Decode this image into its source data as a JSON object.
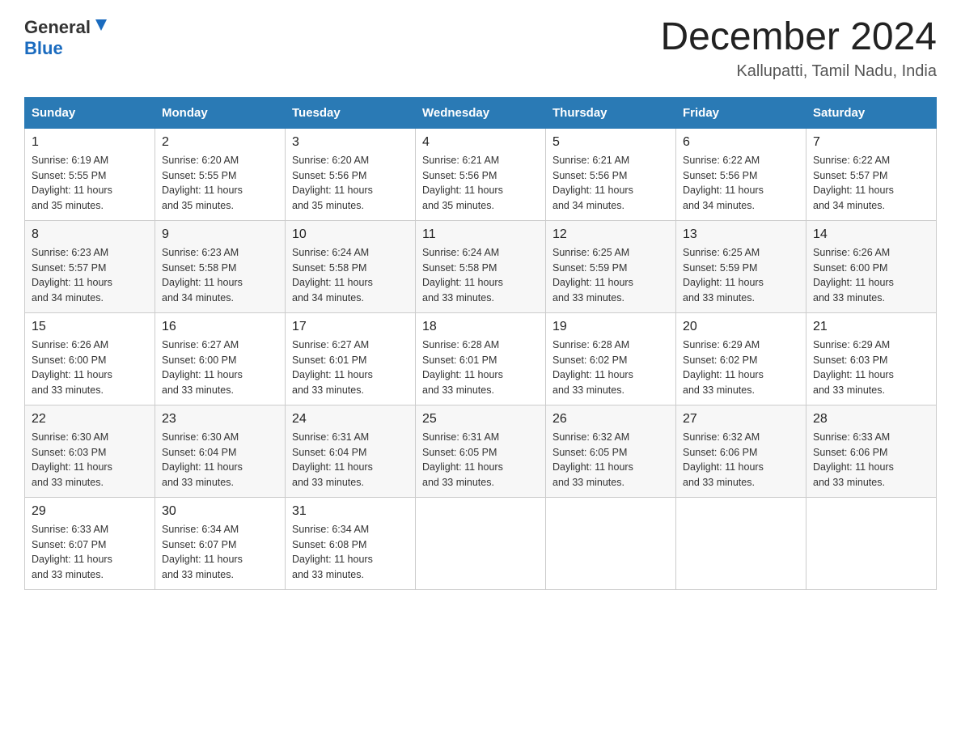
{
  "header": {
    "logo_general": "General",
    "logo_blue": "Blue",
    "title": "December 2024",
    "subtitle": "Kallupatti, Tamil Nadu, India"
  },
  "days_of_week": [
    "Sunday",
    "Monday",
    "Tuesday",
    "Wednesday",
    "Thursday",
    "Friday",
    "Saturday"
  ],
  "weeks": [
    [
      {
        "num": "1",
        "sunrise": "6:19 AM",
        "sunset": "5:55 PM",
        "daylight": "11 hours and 35 minutes."
      },
      {
        "num": "2",
        "sunrise": "6:20 AM",
        "sunset": "5:55 PM",
        "daylight": "11 hours and 35 minutes."
      },
      {
        "num": "3",
        "sunrise": "6:20 AM",
        "sunset": "5:56 PM",
        "daylight": "11 hours and 35 minutes."
      },
      {
        "num": "4",
        "sunrise": "6:21 AM",
        "sunset": "5:56 PM",
        "daylight": "11 hours and 35 minutes."
      },
      {
        "num": "5",
        "sunrise": "6:21 AM",
        "sunset": "5:56 PM",
        "daylight": "11 hours and 34 minutes."
      },
      {
        "num": "6",
        "sunrise": "6:22 AM",
        "sunset": "5:56 PM",
        "daylight": "11 hours and 34 minutes."
      },
      {
        "num": "7",
        "sunrise": "6:22 AM",
        "sunset": "5:57 PM",
        "daylight": "11 hours and 34 minutes."
      }
    ],
    [
      {
        "num": "8",
        "sunrise": "6:23 AM",
        "sunset": "5:57 PM",
        "daylight": "11 hours and 34 minutes."
      },
      {
        "num": "9",
        "sunrise": "6:23 AM",
        "sunset": "5:58 PM",
        "daylight": "11 hours and 34 minutes."
      },
      {
        "num": "10",
        "sunrise": "6:24 AM",
        "sunset": "5:58 PM",
        "daylight": "11 hours and 34 minutes."
      },
      {
        "num": "11",
        "sunrise": "6:24 AM",
        "sunset": "5:58 PM",
        "daylight": "11 hours and 33 minutes."
      },
      {
        "num": "12",
        "sunrise": "6:25 AM",
        "sunset": "5:59 PM",
        "daylight": "11 hours and 33 minutes."
      },
      {
        "num": "13",
        "sunrise": "6:25 AM",
        "sunset": "5:59 PM",
        "daylight": "11 hours and 33 minutes."
      },
      {
        "num": "14",
        "sunrise": "6:26 AM",
        "sunset": "6:00 PM",
        "daylight": "11 hours and 33 minutes."
      }
    ],
    [
      {
        "num": "15",
        "sunrise": "6:26 AM",
        "sunset": "6:00 PM",
        "daylight": "11 hours and 33 minutes."
      },
      {
        "num": "16",
        "sunrise": "6:27 AM",
        "sunset": "6:00 PM",
        "daylight": "11 hours and 33 minutes."
      },
      {
        "num": "17",
        "sunrise": "6:27 AM",
        "sunset": "6:01 PM",
        "daylight": "11 hours and 33 minutes."
      },
      {
        "num": "18",
        "sunrise": "6:28 AM",
        "sunset": "6:01 PM",
        "daylight": "11 hours and 33 minutes."
      },
      {
        "num": "19",
        "sunrise": "6:28 AM",
        "sunset": "6:02 PM",
        "daylight": "11 hours and 33 minutes."
      },
      {
        "num": "20",
        "sunrise": "6:29 AM",
        "sunset": "6:02 PM",
        "daylight": "11 hours and 33 minutes."
      },
      {
        "num": "21",
        "sunrise": "6:29 AM",
        "sunset": "6:03 PM",
        "daylight": "11 hours and 33 minutes."
      }
    ],
    [
      {
        "num": "22",
        "sunrise": "6:30 AM",
        "sunset": "6:03 PM",
        "daylight": "11 hours and 33 minutes."
      },
      {
        "num": "23",
        "sunrise": "6:30 AM",
        "sunset": "6:04 PM",
        "daylight": "11 hours and 33 minutes."
      },
      {
        "num": "24",
        "sunrise": "6:31 AM",
        "sunset": "6:04 PM",
        "daylight": "11 hours and 33 minutes."
      },
      {
        "num": "25",
        "sunrise": "6:31 AM",
        "sunset": "6:05 PM",
        "daylight": "11 hours and 33 minutes."
      },
      {
        "num": "26",
        "sunrise": "6:32 AM",
        "sunset": "6:05 PM",
        "daylight": "11 hours and 33 minutes."
      },
      {
        "num": "27",
        "sunrise": "6:32 AM",
        "sunset": "6:06 PM",
        "daylight": "11 hours and 33 minutes."
      },
      {
        "num": "28",
        "sunrise": "6:33 AM",
        "sunset": "6:06 PM",
        "daylight": "11 hours and 33 minutes."
      }
    ],
    [
      {
        "num": "29",
        "sunrise": "6:33 AM",
        "sunset": "6:07 PM",
        "daylight": "11 hours and 33 minutes."
      },
      {
        "num": "30",
        "sunrise": "6:34 AM",
        "sunset": "6:07 PM",
        "daylight": "11 hours and 33 minutes."
      },
      {
        "num": "31",
        "sunrise": "6:34 AM",
        "sunset": "6:08 PM",
        "daylight": "11 hours and 33 minutes."
      },
      null,
      null,
      null,
      null
    ]
  ],
  "labels": {
    "sunrise": "Sunrise:",
    "sunset": "Sunset:",
    "daylight": "Daylight:"
  }
}
